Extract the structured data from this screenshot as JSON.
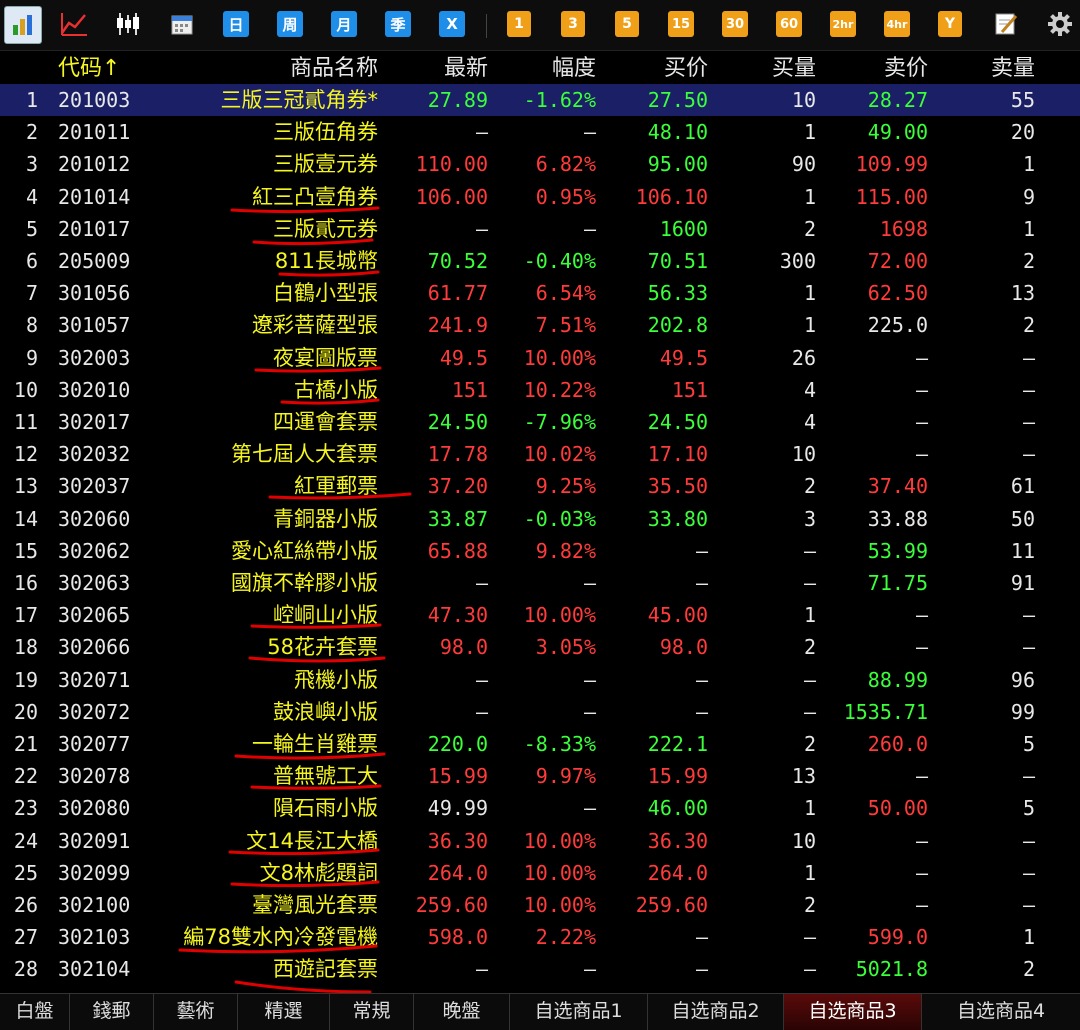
{
  "toolbar": {
    "icons": [
      "bar-chart-icon",
      "line-chart-icon",
      "candlestick-icon",
      "calendar-icon"
    ],
    "period_buttons": [
      "日",
      "周",
      "月",
      "季",
      "X"
    ],
    "minute_buttons": [
      "1",
      "3",
      "5",
      "15",
      "30",
      "60",
      "2hr",
      "4hr",
      "Y"
    ],
    "tools": [
      "edit-icon",
      "gear-icon"
    ]
  },
  "header": {
    "code": "代码↑",
    "name": "商品名称",
    "last": "最新",
    "pct": "幅度",
    "bid": "买价",
    "bid_vol": "买量",
    "ask": "卖价",
    "ask_vol": "卖量"
  },
  "rows": [
    {
      "i": "1",
      "code": "201003",
      "name": "三版三冠貳角券*",
      "last": "27.89",
      "lc": "green",
      "pct": "-1.62%",
      "pc": "green",
      "bid": "27.50",
      "bc": "green",
      "bv": "10",
      "ask": "28.27",
      "ac": "green",
      "av": "55"
    },
    {
      "i": "2",
      "code": "201011",
      "name": "三版伍角券",
      "last": "—",
      "lc": "white",
      "pct": "—",
      "pc": "white",
      "bid": "48.10",
      "bc": "green",
      "bv": "1",
      "ask": "49.00",
      "ac": "green",
      "av": "20"
    },
    {
      "i": "3",
      "code": "201012",
      "name": "三版壹元券",
      "last": "110.00",
      "lc": "red",
      "pct": "6.82%",
      "pc": "red",
      "bid": "95.00",
      "bc": "green",
      "bv": "90",
      "ask": "109.99",
      "ac": "red",
      "av": "1"
    },
    {
      "i": "4",
      "code": "201014",
      "name": "紅三凸壹角券",
      "last": "106.00",
      "lc": "red",
      "pct": "0.95%",
      "pc": "red",
      "bid": "106.10",
      "bc": "red",
      "bv": "1",
      "ask": "115.00",
      "ac": "red",
      "av": "9"
    },
    {
      "i": "5",
      "code": "201017",
      "name": "三版貳元券",
      "last": "—",
      "lc": "white",
      "pct": "—",
      "pc": "white",
      "bid": "1600",
      "bc": "green",
      "bv": "2",
      "ask": "1698",
      "ac": "red",
      "av": "1"
    },
    {
      "i": "6",
      "code": "205009",
      "name": "811長城幣",
      "last": "70.52",
      "lc": "green",
      "pct": "-0.40%",
      "pc": "green",
      "bid": "70.51",
      "bc": "green",
      "bv": "300",
      "ask": "72.00",
      "ac": "red",
      "av": "2"
    },
    {
      "i": "7",
      "code": "301056",
      "name": "白鶴小型張",
      "last": "61.77",
      "lc": "red",
      "pct": "6.54%",
      "pc": "red",
      "bid": "56.33",
      "bc": "green",
      "bv": "1",
      "ask": "62.50",
      "ac": "red",
      "av": "13"
    },
    {
      "i": "8",
      "code": "301057",
      "name": "遼彩菩薩型張",
      "last": "241.9",
      "lc": "red",
      "pct": "7.51%",
      "pc": "red",
      "bid": "202.8",
      "bc": "green",
      "bv": "1",
      "ask": "225.0",
      "ac": "white",
      "av": "2"
    },
    {
      "i": "9",
      "code": "302003",
      "name": "夜宴圖版票",
      "last": "49.5",
      "lc": "red",
      "pct": "10.00%",
      "pc": "red",
      "bid": "49.5",
      "bc": "red",
      "bv": "26",
      "ask": "—",
      "ac": "white",
      "av": "—"
    },
    {
      "i": "10",
      "code": "302010",
      "name": "古橋小版",
      "last": "151",
      "lc": "red",
      "pct": "10.22%",
      "pc": "red",
      "bid": "151",
      "bc": "red",
      "bv": "4",
      "ask": "—",
      "ac": "white",
      "av": "—"
    },
    {
      "i": "11",
      "code": "302017",
      "name": "四運會套票",
      "last": "24.50",
      "lc": "green",
      "pct": "-7.96%",
      "pc": "green",
      "bid": "24.50",
      "bc": "green",
      "bv": "4",
      "ask": "—",
      "ac": "white",
      "av": "—"
    },
    {
      "i": "12",
      "code": "302032",
      "name": "第七屆人大套票",
      "last": "17.78",
      "lc": "red",
      "pct": "10.02%",
      "pc": "red",
      "bid": "17.10",
      "bc": "red",
      "bv": "10",
      "ask": "—",
      "ac": "white",
      "av": "—"
    },
    {
      "i": "13",
      "code": "302037",
      "name": "紅軍郵票",
      "last": "37.20",
      "lc": "red",
      "pct": "9.25%",
      "pc": "red",
      "bid": "35.50",
      "bc": "red",
      "bv": "2",
      "ask": "37.40",
      "ac": "red",
      "av": "61"
    },
    {
      "i": "14",
      "code": "302060",
      "name": "青銅器小版",
      "last": "33.87",
      "lc": "green",
      "pct": "-0.03%",
      "pc": "green",
      "bid": "33.80",
      "bc": "green",
      "bv": "3",
      "ask": "33.88",
      "ac": "white",
      "av": "50"
    },
    {
      "i": "15",
      "code": "302062",
      "name": "愛心紅絲帶小版",
      "last": "65.88",
      "lc": "red",
      "pct": "9.82%",
      "pc": "red",
      "bid": "—",
      "bc": "white",
      "bv": "—",
      "ask": "53.99",
      "ac": "green",
      "av": "11"
    },
    {
      "i": "16",
      "code": "302063",
      "name": "國旗不幹膠小版",
      "last": "—",
      "lc": "white",
      "pct": "—",
      "pc": "white",
      "bid": "—",
      "bc": "white",
      "bv": "—",
      "ask": "71.75",
      "ac": "green",
      "av": "91"
    },
    {
      "i": "17",
      "code": "302065",
      "name": "崆峒山小版",
      "last": "47.30",
      "lc": "red",
      "pct": "10.00%",
      "pc": "red",
      "bid": "45.00",
      "bc": "red",
      "bv": "1",
      "ask": "—",
      "ac": "white",
      "av": "—"
    },
    {
      "i": "18",
      "code": "302066",
      "name": "58花卉套票",
      "last": "98.0",
      "lc": "red",
      "pct": "3.05%",
      "pc": "red",
      "bid": "98.0",
      "bc": "red",
      "bv": "2",
      "ask": "—",
      "ac": "white",
      "av": "—"
    },
    {
      "i": "19",
      "code": "302071",
      "name": "飛機小版",
      "last": "—",
      "lc": "white",
      "pct": "—",
      "pc": "white",
      "bid": "—",
      "bc": "white",
      "bv": "—",
      "ask": "88.99",
      "ac": "green",
      "av": "96"
    },
    {
      "i": "20",
      "code": "302072",
      "name": "鼓浪嶼小版",
      "last": "—",
      "lc": "white",
      "pct": "—",
      "pc": "white",
      "bid": "—",
      "bc": "white",
      "bv": "—",
      "ask": "1535.71",
      "ac": "green",
      "av": "99"
    },
    {
      "i": "21",
      "code": "302077",
      "name": "一輪生肖雞票",
      "last": "220.0",
      "lc": "green",
      "pct": "-8.33%",
      "pc": "green",
      "bid": "222.1",
      "bc": "green",
      "bv": "2",
      "ask": "260.0",
      "ac": "red",
      "av": "5"
    },
    {
      "i": "22",
      "code": "302078",
      "name": "普無號工大",
      "last": "15.99",
      "lc": "red",
      "pct": "9.97%",
      "pc": "red",
      "bid": "15.99",
      "bc": "red",
      "bv": "13",
      "ask": "—",
      "ac": "white",
      "av": "—"
    },
    {
      "i": "23",
      "code": "302080",
      "name": "隕石雨小版",
      "last": "49.99",
      "lc": "white",
      "pct": "—",
      "pc": "white",
      "bid": "46.00",
      "bc": "green",
      "bv": "1",
      "ask": "50.00",
      "ac": "red",
      "av": "5"
    },
    {
      "i": "24",
      "code": "302091",
      "name": "文14長江大橋",
      "last": "36.30",
      "lc": "red",
      "pct": "10.00%",
      "pc": "red",
      "bid": "36.30",
      "bc": "red",
      "bv": "10",
      "ask": "—",
      "ac": "white",
      "av": "—"
    },
    {
      "i": "25",
      "code": "302099",
      "name": "文8林彪題詞",
      "last": "264.0",
      "lc": "red",
      "pct": "10.00%",
      "pc": "red",
      "bid": "264.0",
      "bc": "red",
      "bv": "1",
      "ask": "—",
      "ac": "white",
      "av": "—"
    },
    {
      "i": "26",
      "code": "302100",
      "name": "臺灣風光套票",
      "last": "259.60",
      "lc": "red",
      "pct": "10.00%",
      "pc": "red",
      "bid": "259.60",
      "bc": "red",
      "bv": "2",
      "ask": "—",
      "ac": "white",
      "av": "—"
    },
    {
      "i": "27",
      "code": "302103",
      "name": "編78雙水內冷發電機",
      "last": "598.0",
      "lc": "red",
      "pct": "2.22%",
      "pc": "red",
      "bid": "—",
      "bc": "white",
      "bv": "—",
      "ask": "599.0",
      "ac": "red",
      "av": "1"
    },
    {
      "i": "28",
      "code": "302104",
      "name": "西遊記套票",
      "last": "—",
      "lc": "white",
      "pct": "—",
      "pc": "white",
      "bid": "—",
      "bc": "white",
      "bv": "—",
      "ask": "5021.8",
      "ac": "green",
      "av": "2"
    }
  ],
  "tabs": [
    "白盤",
    "錢郵",
    "藝術",
    "精選",
    "常規",
    "晚盤",
    "自选商品1",
    "自选商品2",
    "自选商品3",
    "自选商品4"
  ],
  "active_tab": "自选商品3",
  "colors": {
    "up": "#ff3b3b",
    "down": "#3bff3b",
    "name": "#f5f520",
    "selected_row": "#1a1f66",
    "underline": "#e00000"
  }
}
